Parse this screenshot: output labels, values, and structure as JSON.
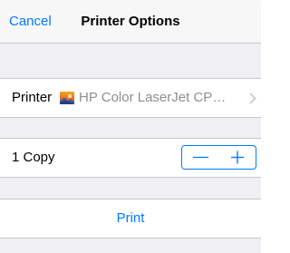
{
  "navbar": {
    "cancel_label": "Cancel",
    "title": "Printer Options"
  },
  "printer_row": {
    "label": "Printer",
    "printer_name": "HP Color LaserJet CP…",
    "icon": "printer-photo-icon",
    "chevron": "chevron-right-icon"
  },
  "copies_row": {
    "label": "1 Copy",
    "count": 1,
    "decrement_icon": "minus-icon",
    "increment_icon": "plus-icon"
  },
  "print_row": {
    "label": "Print"
  },
  "colors": {
    "accent": "#007aff",
    "background": "#efeff4",
    "separator": "#c8c7cc",
    "secondary_text": "#8e8e93"
  }
}
